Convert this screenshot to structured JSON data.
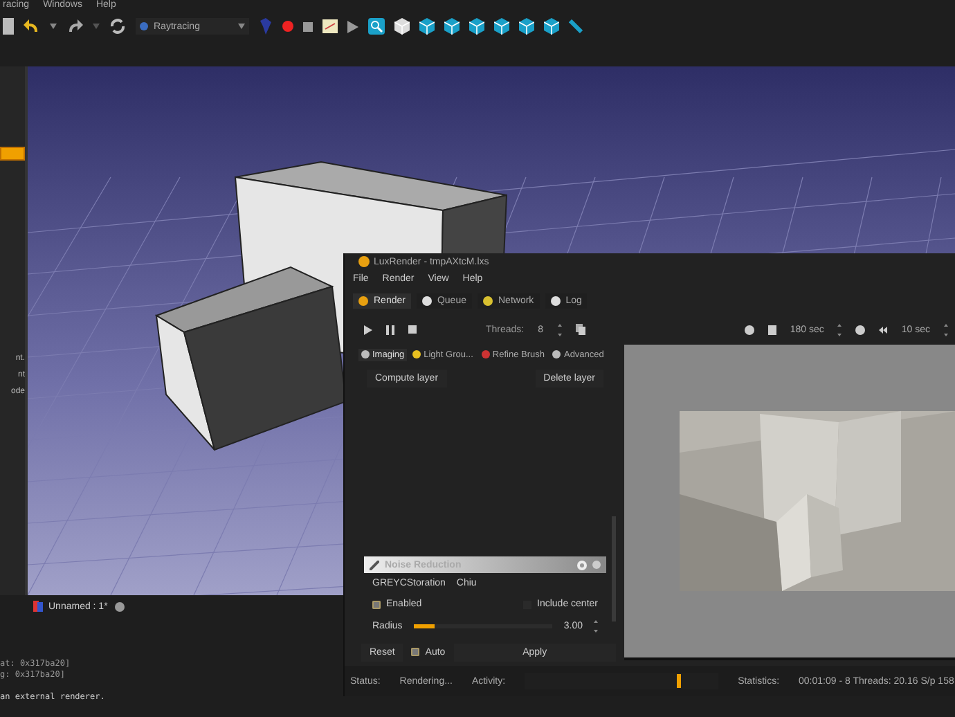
{
  "menu": [
    {
      "label": "racing"
    },
    {
      "label": "Windows"
    },
    {
      "label": "Help"
    }
  ],
  "toolbar": {
    "renderer": "Raytracing"
  },
  "left_panel": {
    "labels": [
      "nt.",
      "nt",
      "ode"
    ]
  },
  "document_tab": {
    "label": "Unnamed : 1*"
  },
  "console": [
    "at: 0x317ba20]",
    "g: 0x317ba20]",
    "an external renderer."
  ],
  "lux": {
    "title": "LuxRender - tmpAXtcM.lxs",
    "menus": [
      "File",
      "Render",
      "View",
      "Help"
    ],
    "tabs": [
      {
        "label": "Render",
        "selected": true
      },
      {
        "label": "Queue",
        "selected": false
      },
      {
        "label": "Network",
        "selected": false
      },
      {
        "label": "Log",
        "selected": false
      }
    ],
    "threads_label": "Threads:",
    "threads": "8",
    "halt_time": "180 sec",
    "refresh_time": "10 sec",
    "subtabs": [
      {
        "label": "Imaging",
        "selected": true
      },
      {
        "label": "Light Grou...",
        "selected": false
      },
      {
        "label": "Refine Brush",
        "selected": false
      },
      {
        "label": "Advanced",
        "selected": false
      }
    ],
    "compute_layer": "Compute layer",
    "delete_layer": "Delete layer",
    "noise_reduction": {
      "title": "Noise Reduction",
      "disabled": true
    },
    "filter_label": "GREYCStoration",
    "filter_value": "Chiu",
    "enabled": {
      "label": "Enabled",
      "checked": true
    },
    "include_center": {
      "label": "Include center",
      "checked": false
    },
    "radius": {
      "label": "Radius",
      "level": 0.15,
      "reading": "3.00"
    },
    "reset": "Reset",
    "auto": {
      "label": "Auto",
      "checked": true
    },
    "apply": "Apply",
    "status_label": "Status:",
    "status": "Rendering...",
    "activity_label": "Activity:",
    "statistics_label": "Statistics:",
    "statistics": "00:01:09 - 8 Threads: 20.16 S/p 158"
  }
}
